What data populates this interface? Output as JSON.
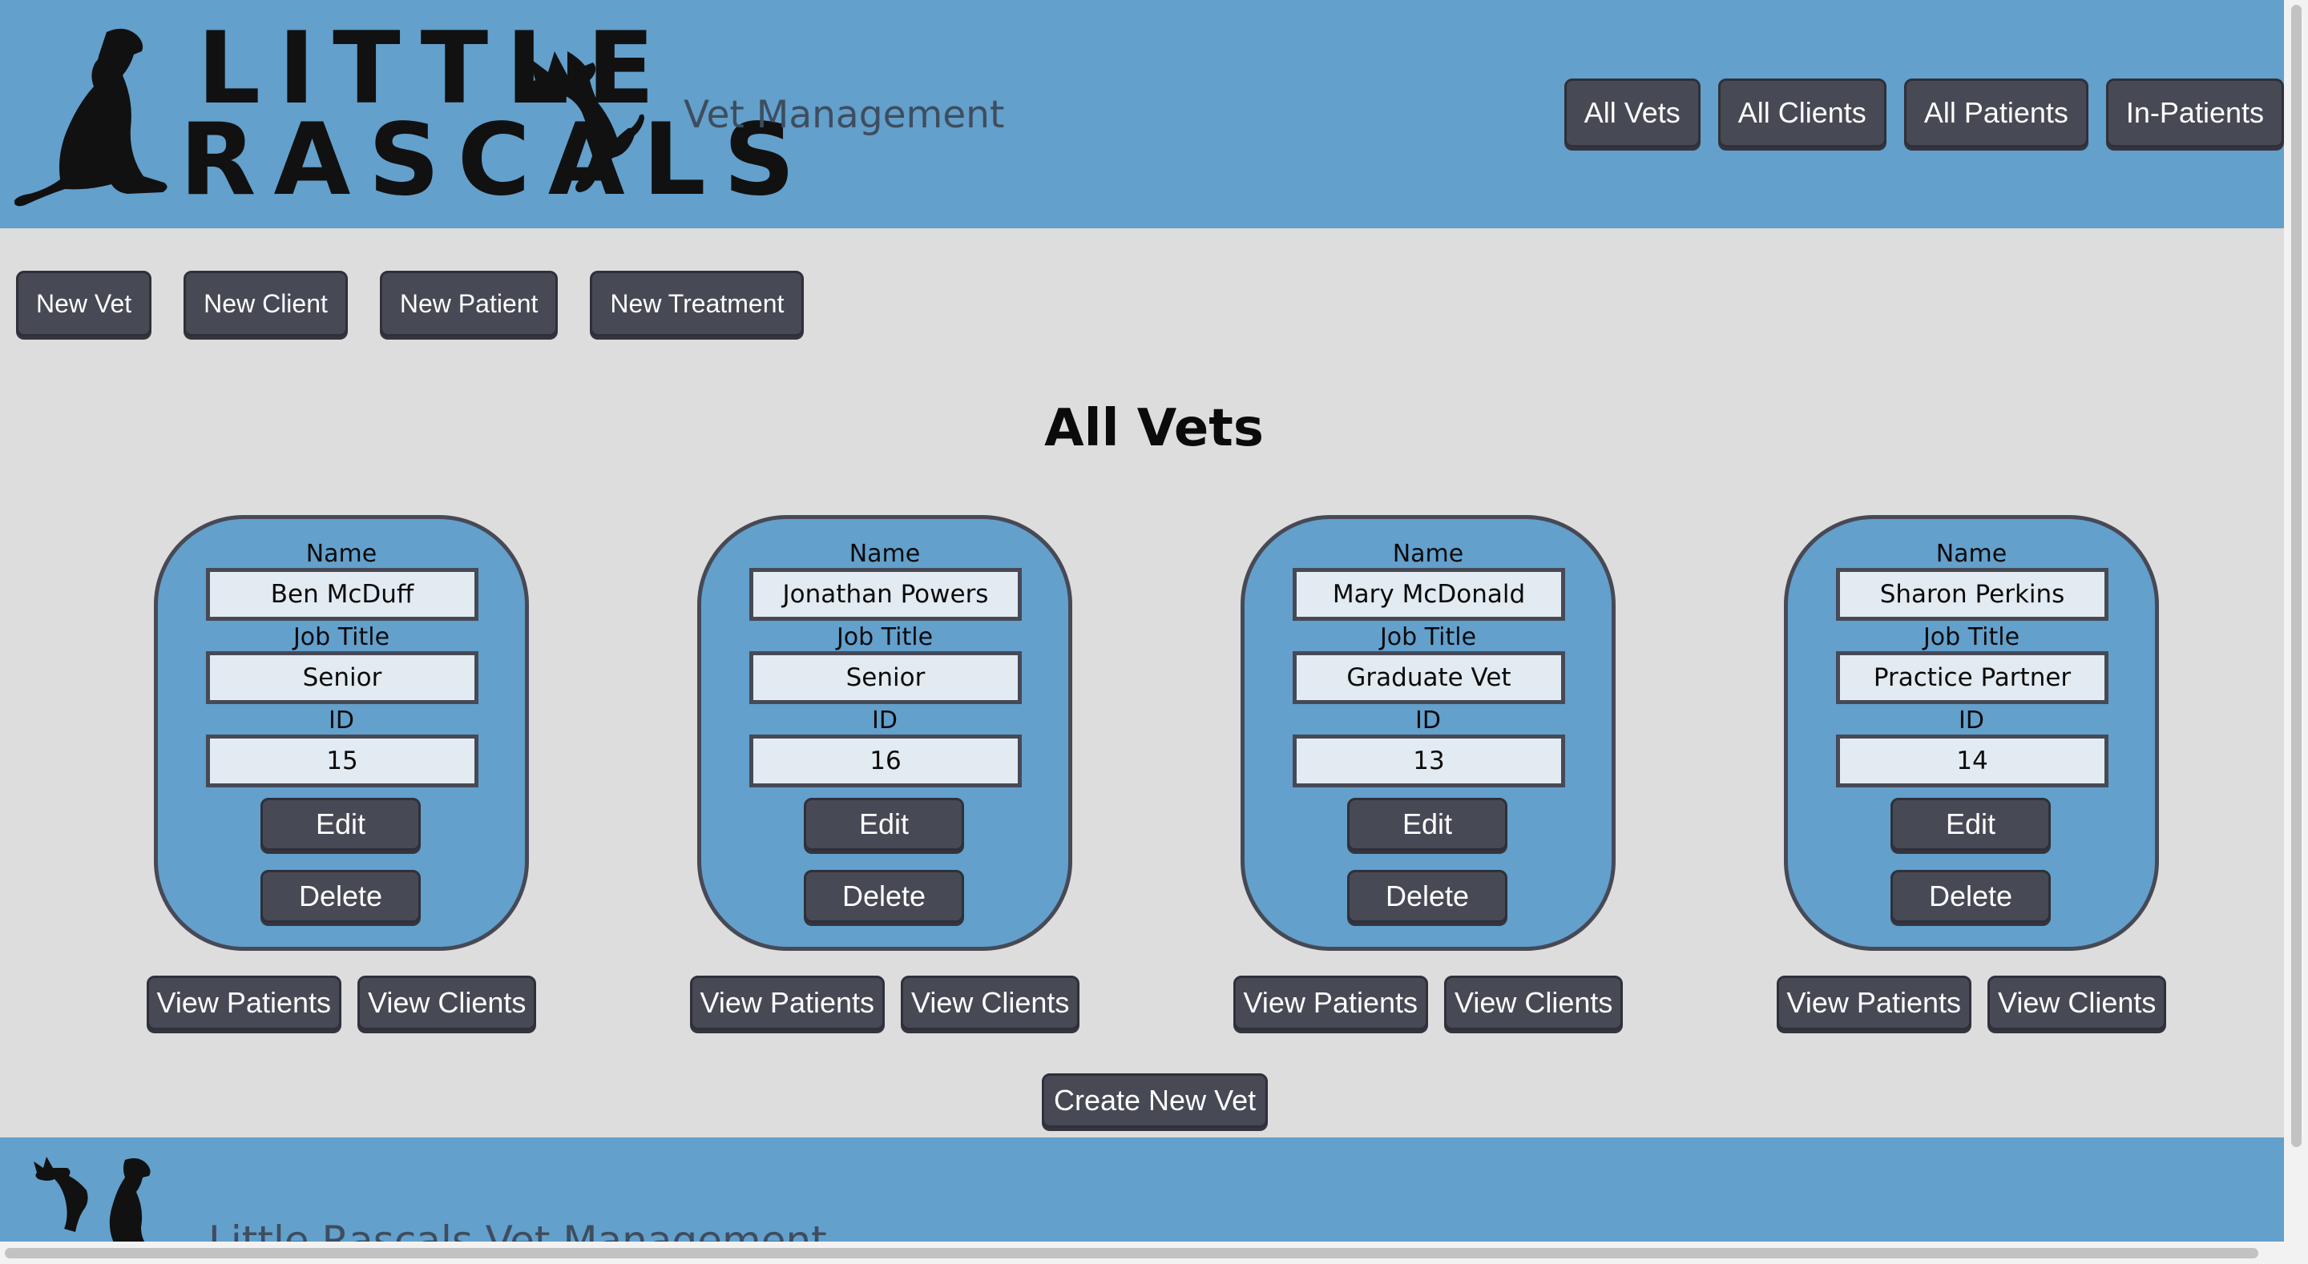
{
  "header": {
    "logo_line1": "LITTLE",
    "logo_line2": "RASCALS",
    "app_title": "Vet Management",
    "nav": [
      {
        "label": "All Vets"
      },
      {
        "label": "All Clients"
      },
      {
        "label": "All Patients"
      },
      {
        "label": "In-Patients"
      }
    ]
  },
  "actions": [
    {
      "label": "New Vet"
    },
    {
      "label": "New Client"
    },
    {
      "label": "New Patient"
    },
    {
      "label": "New Treatment"
    }
  ],
  "main": {
    "title": "All Vets",
    "field_labels": {
      "name": "Name",
      "job_title": "Job Title",
      "id": "ID"
    },
    "card_buttons": {
      "edit": "Edit",
      "delete": "Delete",
      "view_patients": "View Patients",
      "view_clients": "View Clients"
    },
    "vets": [
      {
        "name": "Ben McDuff",
        "job_title": "Senior",
        "id": "15"
      },
      {
        "name": "Jonathan Powers",
        "job_title": "Senior",
        "id": "16"
      },
      {
        "name": "Mary McDonald",
        "job_title": "Graduate Vet",
        "id": "13"
      },
      {
        "name": "Sharon Perkins",
        "job_title": "Practice Partner",
        "id": "14"
      }
    ],
    "create_button": "Create New Vet"
  },
  "footer": {
    "text": "Little Rascals Vet Management"
  },
  "colors": {
    "header_blue": "#63a0cc",
    "background": "#dcdddc",
    "button": "#474955",
    "field_bg": "#e2ebf1"
  }
}
